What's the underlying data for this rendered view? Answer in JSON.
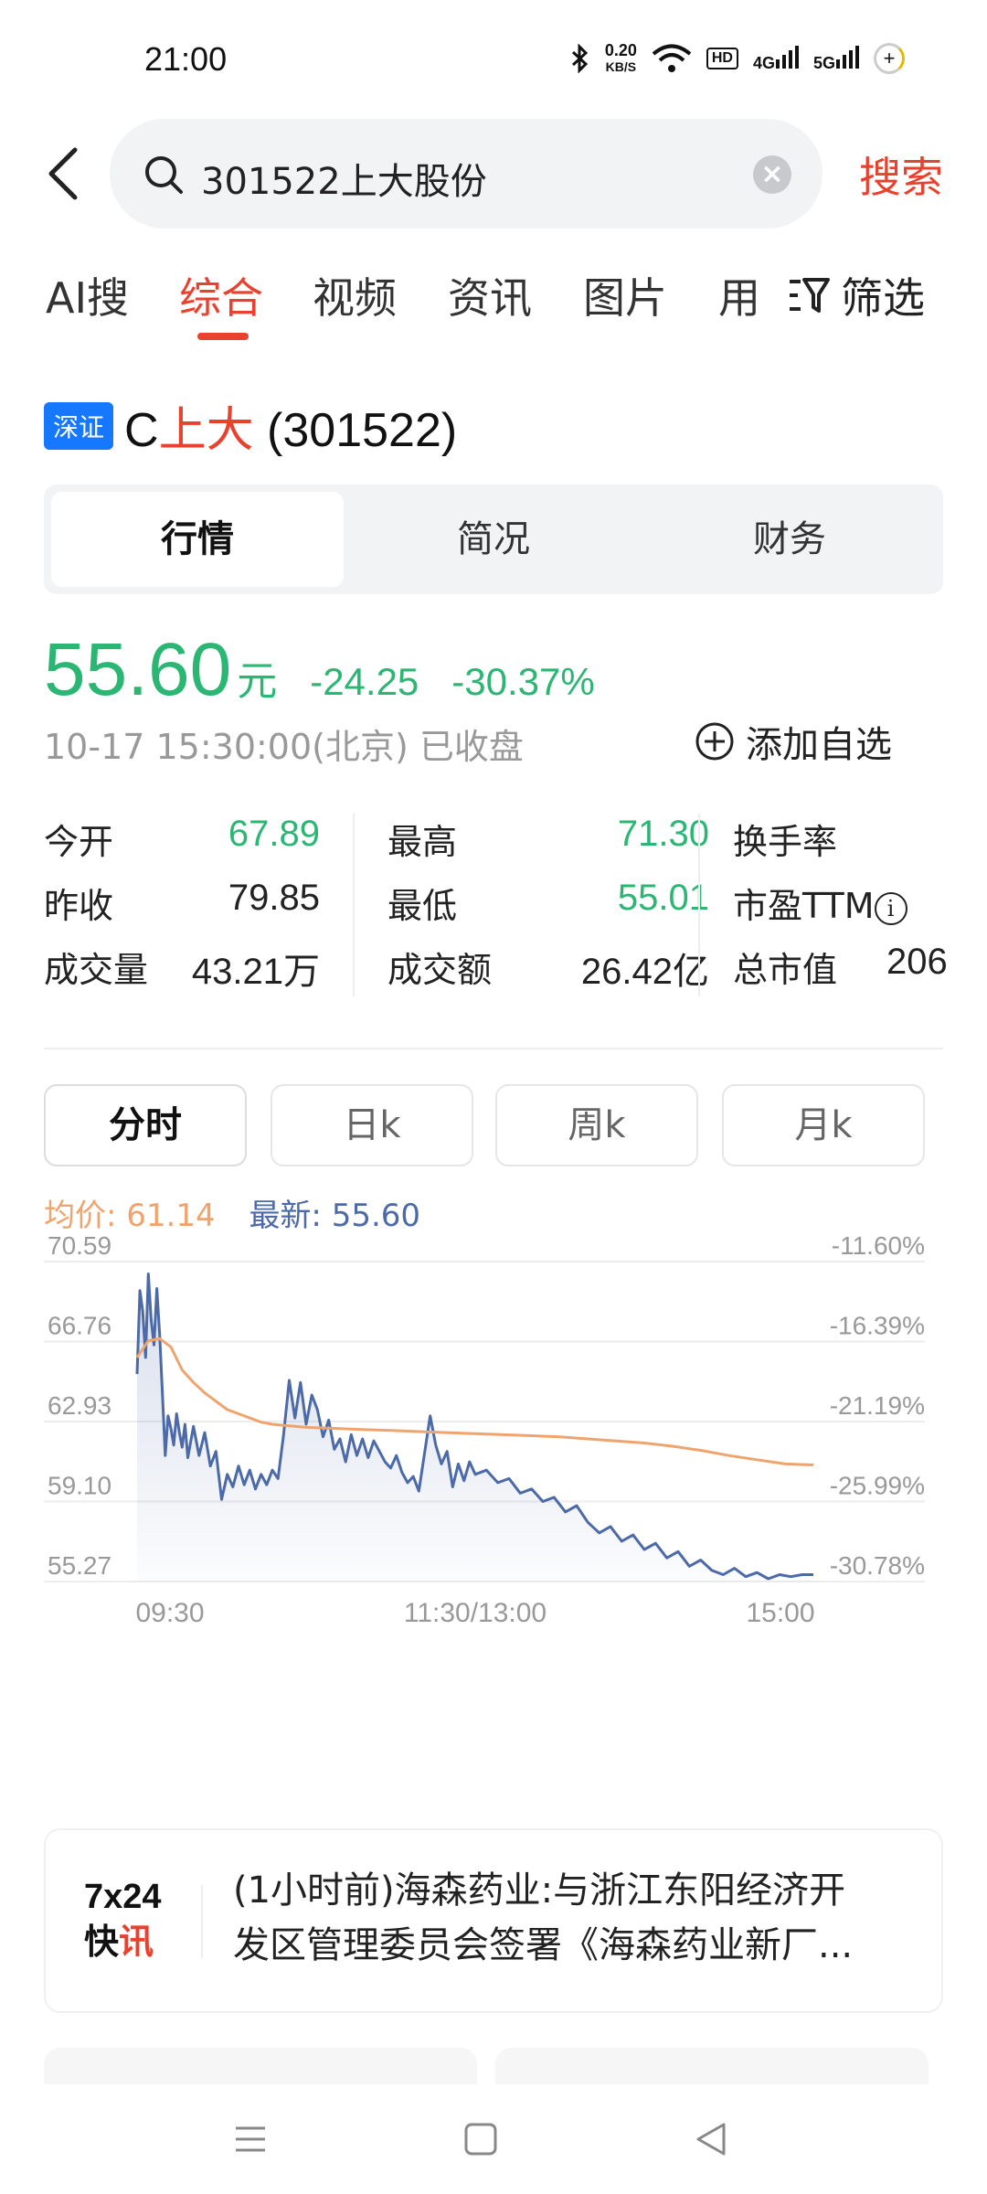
{
  "status_bar": {
    "time": "21:00",
    "net_speed_value": "0.20",
    "net_speed_unit": "KB/S",
    "hd_label": "HD",
    "signal_1": "4G",
    "signal_2": "5G",
    "icons": [
      "bluetooth-icon",
      "wifi-icon",
      "signal-icon",
      "battery-icon"
    ]
  },
  "search": {
    "query": "301522上大股份",
    "button_label": "搜索"
  },
  "tabs": [
    {
      "label": "AI搜",
      "active": false
    },
    {
      "label": "综合",
      "active": true
    },
    {
      "label": "视频",
      "active": false
    },
    {
      "label": "资讯",
      "active": false
    },
    {
      "label": "图片",
      "active": false
    },
    {
      "label": "用",
      "active": false
    }
  ],
  "filter_label": "筛选",
  "stock": {
    "exchange_badge": "深证",
    "name_prefix": "C",
    "name_highlight": "上大",
    "code": " (301522)"
  },
  "segments": [
    {
      "label": "行情",
      "active": true
    },
    {
      "label": "简况",
      "active": false
    },
    {
      "label": "财务",
      "active": false
    }
  ],
  "quote": {
    "price": "55.60",
    "unit": "元",
    "change": "-24.25",
    "change_pct": "-30.37%",
    "timestamp": "10-17 15:30:00(北京) 已收盘",
    "add_watch_label": "添加自选"
  },
  "stats": [
    {
      "label": "今开",
      "value": "67.89",
      "green": true
    },
    {
      "label": "最高",
      "value": "71.30",
      "green": true
    },
    {
      "label": "换手率",
      "value": "",
      "green": false
    },
    {
      "label": "昨收",
      "value": "79.85",
      "green": false
    },
    {
      "label": "最低",
      "value": "55.01",
      "green": true
    },
    {
      "label": "市盈TTM",
      "value": "",
      "green": false
    },
    {
      "label": "成交量",
      "value": "43.21万",
      "green": false
    },
    {
      "label": "成交额",
      "value": "26.42亿",
      "green": false
    },
    {
      "label": "总市值",
      "value": "206",
      "green": false
    }
  ],
  "periods": [
    {
      "label": "分时",
      "active": true
    },
    {
      "label": "日k",
      "active": false
    },
    {
      "label": "周k",
      "active": false
    },
    {
      "label": "月k",
      "active": false
    }
  ],
  "legend": {
    "avg_label": "均价:",
    "avg_value": "61.14",
    "last_label": "最新:",
    "last_value": "55.60"
  },
  "chart_data": {
    "type": "line",
    "title": "",
    "y_left_ticks": [
      "70.59",
      "66.76",
      "62.93",
      "59.10",
      "55.27"
    ],
    "y_right_ticks": [
      "-11.60%",
      "-16.39%",
      "-21.19%",
      "-25.99%",
      "-30.78%"
    ],
    "x_ticks": [
      "09:30",
      "11:30/13:00",
      "15:00"
    ],
    "ylim": [
      55.27,
      70.59
    ],
    "x_minutes_total": 240,
    "series": [
      {
        "name": "最新",
        "color": "#4c6aa8",
        "x": [
          0,
          1,
          2,
          3,
          4,
          5,
          6,
          7,
          8,
          9,
          10,
          11,
          12,
          13,
          14,
          15,
          16,
          17,
          18,
          20,
          22,
          24,
          26,
          28,
          30,
          32,
          34,
          36,
          38,
          40,
          42,
          44,
          46,
          48,
          50,
          52,
          54,
          56,
          58,
          60,
          62,
          64,
          66,
          68,
          70,
          72,
          74,
          76,
          78,
          80,
          82,
          84,
          86,
          88,
          90,
          92,
          94,
          96,
          98,
          100,
          102,
          104,
          106,
          108,
          110,
          112,
          114,
          116,
          118,
          120,
          124,
          128,
          132,
          136,
          140,
          144,
          148,
          152,
          156,
          160,
          164,
          168,
          172,
          176,
          180,
          184,
          188,
          192,
          196,
          200,
          204,
          208,
          212,
          216,
          220,
          224,
          228,
          232,
          236,
          240
        ],
        "values": [
          65.2,
          69.2,
          68.2,
          66.0,
          70.0,
          67.8,
          66.6,
          69.3,
          67.1,
          64.2,
          61.3,
          63.2,
          62.6,
          61.8,
          63.3,
          62.4,
          61.7,
          62.8,
          61.2,
          62.7,
          61.3,
          62.4,
          60.8,
          61.5,
          59.2,
          60.4,
          59.8,
          60.8,
          59.9,
          60.6,
          59.7,
          60.4,
          59.9,
          60.6,
          60.2,
          62.3,
          64.9,
          63.1,
          64.8,
          62.8,
          64.2,
          63.5,
          62.2,
          63.0,
          61.6,
          62.1,
          61.0,
          62.3,
          61.3,
          62.1,
          61.2,
          62.0,
          61.5,
          61.0,
          60.7,
          61.3,
          60.5,
          60.0,
          60.3,
          59.6,
          61.4,
          63.2,
          61.8,
          60.9,
          61.5,
          59.8,
          60.9,
          60.1,
          61.0,
          60.4,
          60.6,
          60.0,
          60.2,
          59.5,
          59.7,
          59.1,
          59.3,
          58.6,
          58.9,
          58.1,
          57.6,
          57.9,
          57.2,
          57.5,
          56.8,
          57.1,
          56.4,
          56.7,
          56.0,
          56.3,
          55.8,
          55.6,
          55.9,
          55.5,
          55.7,
          55.4,
          55.6,
          55.5,
          55.6,
          55.6
        ]
      },
      {
        "name": "均价",
        "color": "#f0a46d",
        "x": [
          0,
          4,
          8,
          12,
          16,
          20,
          24,
          28,
          32,
          36,
          40,
          44,
          48,
          52,
          56,
          60,
          70,
          80,
          90,
          100,
          110,
          120,
          130,
          140,
          150,
          160,
          170,
          180,
          190,
          200,
          210,
          220,
          230,
          240
        ],
        "values": [
          66.0,
          66.8,
          66.9,
          66.5,
          65.4,
          64.8,
          64.3,
          63.9,
          63.5,
          63.3,
          63.1,
          62.9,
          62.8,
          62.75,
          62.7,
          62.65,
          62.6,
          62.55,
          62.5,
          62.45,
          62.4,
          62.35,
          62.3,
          62.25,
          62.2,
          62.1,
          62.0,
          61.9,
          61.75,
          61.55,
          61.3,
          61.1,
          60.9,
          60.85
        ]
      }
    ],
    "grid": true
  },
  "news": {
    "logo_top": "7x24",
    "logo_bottom_a": "快",
    "logo_bottom_b": "讯",
    "line1": "(1小时前)海森药业:与浙江东阳经济开",
    "line2": "发区管理委员会签署《海森药业新厂..."
  }
}
